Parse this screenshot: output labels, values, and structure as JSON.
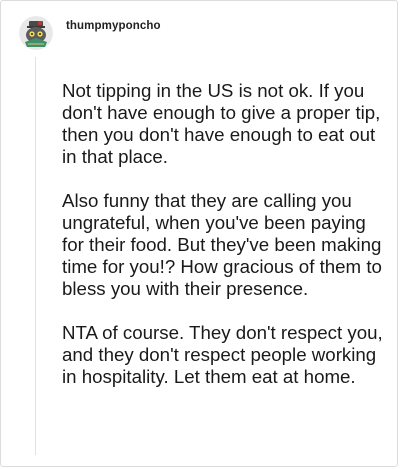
{
  "comment": {
    "username": "thumpmyponcho",
    "paragraphs": [
      "Not tipping in the US is not ok. If you don't have enough to give a proper tip, then you don't have enough to eat out in that place.",
      "Also funny that they are calling you ungrateful, when you've been paying for their food. But they've been making time for you!? How gracious of them to bless you with their presence.",
      "NTA of course. They don't respect you, and they don't respect people working in hospitality. Let them eat at home."
    ]
  },
  "icons": {
    "avatar": "cartoon-character-avatar-icon"
  },
  "colors": {
    "text": "#1a1a1a",
    "border": "#dcdcdc",
    "thread_line": "#e2e2e2"
  }
}
